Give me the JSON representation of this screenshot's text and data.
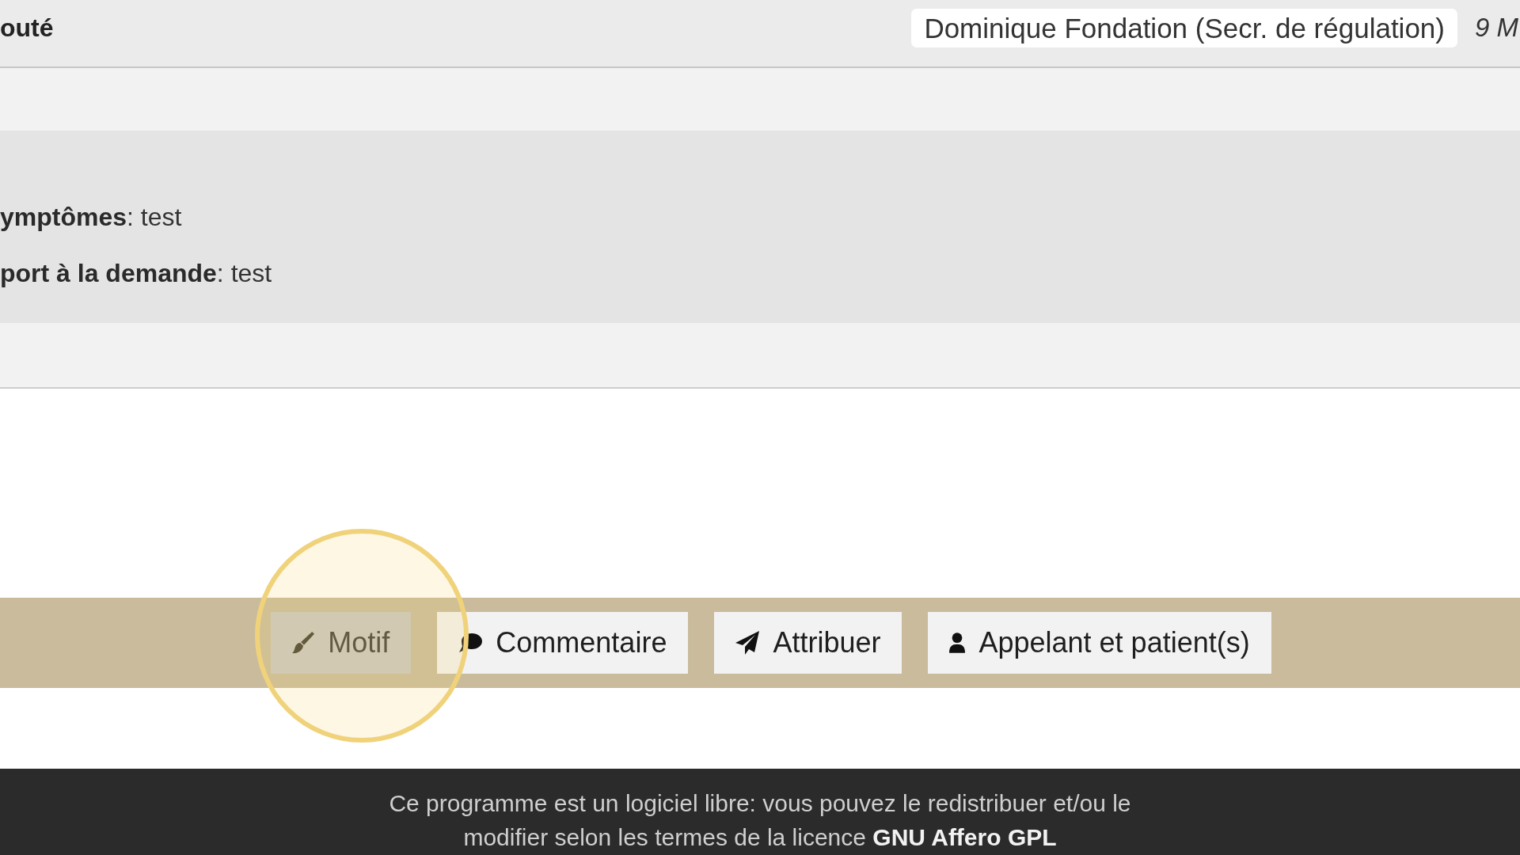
{
  "header": {
    "title": "outé",
    "user": "Dominique Fondation (Secr. de régulation)",
    "date": "9 M"
  },
  "details": [
    "**ymptômes**: test",
    "**port à la demande**: test"
  ],
  "actions": [
    {
      "label": "Motif",
      "disabled": true,
      "highlighted": true
    },
    {
      "label": "Commentaire",
      "disabled": false,
      "highlighted": false
    },
    {
      "label": "Attribuer",
      "disabled": false,
      "highlighted": false
    },
    {
      "label": "Appelant et patient(s)",
      "disabled": false,
      "highlighted": false
    }
  ],
  "footer": {
    "text": "Ce programme est un logiciel libre: vous pouvez le redistribuer et/ou le modifier selon les termes de la licence",
    "link": "GNU Affero GPL"
  }
}
